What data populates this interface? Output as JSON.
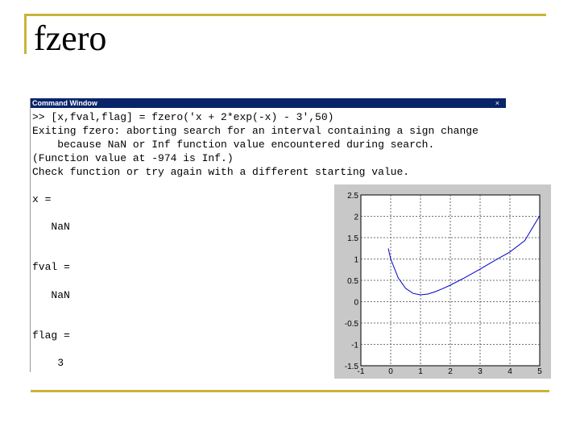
{
  "slide": {
    "title": "fzero"
  },
  "command_window": {
    "title": "Command Window",
    "undock_glyph": "×",
    "lines": [
      ">> [x,fval,flag] = fzero('x + 2*exp(-x) - 3',50)",
      "Exiting fzero: aborting search for an interval containing a sign change",
      "    because NaN or Inf function value encountered during search.",
      "(Function value at -974 is Inf.)",
      "Check function or try again with a different starting value.",
      "",
      "x =",
      "",
      "   NaN",
      "",
      "",
      "fval =",
      "",
      "   NaN",
      "",
      "",
      "flag =",
      "",
      "    3"
    ]
  },
  "chart_data": {
    "type": "line",
    "title": "",
    "xlabel": "",
    "ylabel": "",
    "xlim": [
      -1,
      5
    ],
    "ylim": [
      -1.5,
      2.5
    ],
    "grid": true,
    "xticks": [
      "-1",
      "0",
      "1",
      "2",
      "3",
      "4",
      "5"
    ],
    "yticks": [
      "2.5",
      "2",
      "1.5",
      "1",
      "0.5",
      "0",
      "-0.5",
      "-1",
      "-1.5"
    ],
    "series": [
      {
        "color": "#0000cc",
        "x": [
          -0.08,
          0,
          0.25,
          0.5,
          0.75,
          1,
          1.25,
          1.5,
          1.75,
          2,
          2.5,
          3,
          3.5,
          4,
          4.5,
          5
        ],
        "y": [
          1.25,
          1.0,
          0.558,
          0.313,
          0.195,
          0.16,
          0.18,
          0.236,
          0.307,
          0.387,
          0.568,
          0.763,
          0.967,
          1.165,
          1.433,
          2.013
        ]
      }
    ]
  }
}
